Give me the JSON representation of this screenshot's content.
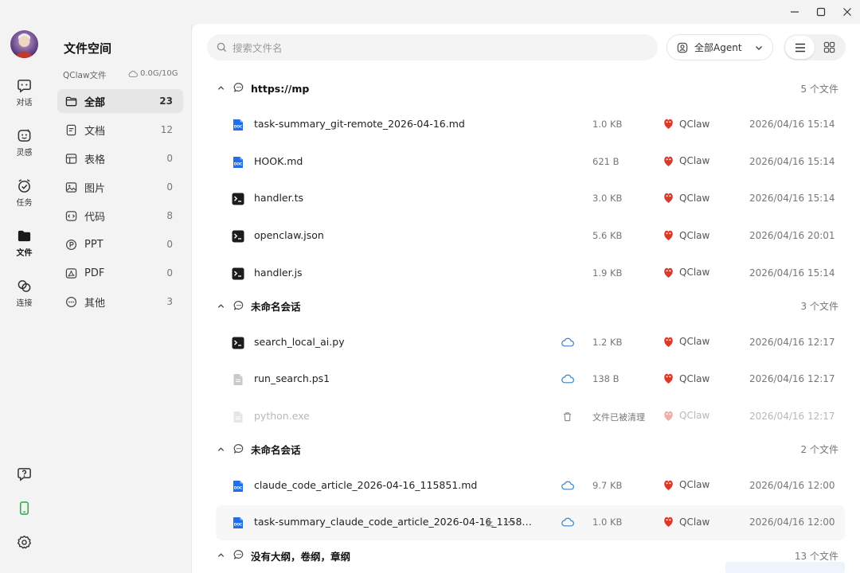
{
  "colors": {
    "accent": "#1f6feb",
    "cloud": "#3b82c4",
    "brand": "#d93a2b",
    "green": "#2eb24a"
  },
  "rail": {
    "items": [
      {
        "label": "对话",
        "icon": "chat-icon"
      },
      {
        "label": "灵感",
        "icon": "sparkle-icon"
      },
      {
        "label": "任务",
        "icon": "task-icon"
      },
      {
        "label": "文件",
        "icon": "folder-icon"
      },
      {
        "label": "连接",
        "icon": "link-icon"
      }
    ]
  },
  "sidebar": {
    "title": "文件空间",
    "subtitle": "QClaw文件",
    "quota": "0.0G/10G",
    "categories": [
      {
        "label": "全部",
        "count": "23",
        "icon": "folder-outline-icon"
      },
      {
        "label": "文档",
        "count": "12",
        "icon": "document-icon"
      },
      {
        "label": "表格",
        "count": "0",
        "icon": "table-icon"
      },
      {
        "label": "图片",
        "count": "0",
        "icon": "image-icon"
      },
      {
        "label": "代码",
        "count": "8",
        "icon": "code-icon"
      },
      {
        "label": "PPT",
        "count": "0",
        "icon": "ppt-icon"
      },
      {
        "label": "PDF",
        "count": "0",
        "icon": "pdf-icon"
      },
      {
        "label": "其他",
        "count": "3",
        "icon": "more-icon"
      }
    ]
  },
  "toolbar": {
    "search_placeholder": "搜索文件名",
    "agent_filter": "全部Agent"
  },
  "groups": [
    {
      "name": "https://mp",
      "count": "5 个文件",
      "files": [
        {
          "name": "task-summary_git-remote_2026-04-16.md",
          "type": "doc",
          "size": "1.0 KB",
          "agent": "QClaw",
          "date": "2026/04/16 15:14"
        },
        {
          "name": "HOOK.md",
          "type": "doc",
          "size": "621 B",
          "agent": "QClaw",
          "date": "2026/04/16 15:14"
        },
        {
          "name": "handler.ts",
          "type": "code",
          "size": "3.0 KB",
          "agent": "QClaw",
          "date": "2026/04/16 15:14"
        },
        {
          "name": "openclaw.json",
          "type": "code",
          "size": "5.6 KB",
          "agent": "QClaw",
          "date": "2026/04/16 20:01"
        },
        {
          "name": "handler.js",
          "type": "code",
          "size": "1.9 KB",
          "agent": "QClaw",
          "date": "2026/04/16 15:14"
        }
      ]
    },
    {
      "name": "未命名会话",
      "count": "3 个文件",
      "files": [
        {
          "name": "search_local_ai.py",
          "type": "code",
          "size": "1.2 KB",
          "agent": "QClaw",
          "date": "2026/04/16 12:17",
          "cloud": true
        },
        {
          "name": "run_search.ps1",
          "type": "generic",
          "size": "138 B",
          "agent": "QClaw",
          "date": "2026/04/16 12:17",
          "cloud": true
        },
        {
          "name": "python.exe",
          "type": "generic",
          "size": "文件已被清理",
          "agent": "QClaw",
          "date": "2026/04/16 12:17",
          "deleted": true
        }
      ]
    },
    {
      "name": "未命名会话",
      "count": "2 个文件",
      "files": [
        {
          "name": "claude_code_article_2026-04-16_115851.md",
          "type": "doc",
          "size": "9.7 KB",
          "agent": "QClaw",
          "date": "2026/04/16 12:00",
          "cloud": true
        },
        {
          "name": "task-summary_claude_code_article_2026-04-16_1158…",
          "type": "doc",
          "size": "1.0 KB",
          "agent": "QClaw",
          "date": "2026/04/16 12:00",
          "cloud": true,
          "hover": true
        }
      ]
    },
    {
      "name": "没有大纲，卷纲，章纲",
      "count": "13 个文件",
      "files": []
    }
  ]
}
